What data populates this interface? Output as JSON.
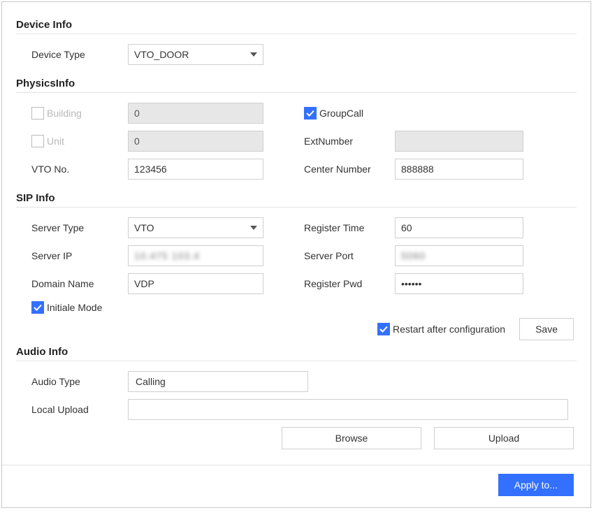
{
  "deviceInfo": {
    "title": "Device Info",
    "deviceTypeLabel": "Device Type",
    "deviceTypeValue": "VTO_DOOR"
  },
  "physicsInfo": {
    "title": "PhysicsInfo",
    "buildingLabel": "Building",
    "buildingChecked": false,
    "buildingValue": "0",
    "unitLabel": "Unit",
    "unitChecked": false,
    "unitValue": "0",
    "vtoNoLabel": "VTO No.",
    "vtoNoValue": "123456",
    "groupCallLabel": "GroupCall",
    "groupCallChecked": true,
    "extNumberLabel": "ExtNumber",
    "extNumberValue": "",
    "centerNumberLabel": "Center Number",
    "centerNumberValue": "888888"
  },
  "sipInfo": {
    "title": "SIP Info",
    "serverTypeLabel": "Server Type",
    "serverTypeValue": "VTO",
    "serverIpLabel": "Server IP",
    "serverIpValue": "10.475 103.4",
    "domainNameLabel": "Domain Name",
    "domainNameValue": "VDP",
    "initModeLabel": "Initiale Mode",
    "initModeChecked": true,
    "registerTimeLabel": "Register Time",
    "registerTimeValue": "60",
    "serverPortLabel": "Server Port",
    "serverPortValue": "5060",
    "registerPwdLabel": "Register Pwd",
    "registerPwdValue": "••••••",
    "restartLabel": "Restart after configuration",
    "restartChecked": true,
    "saveLabel": "Save"
  },
  "audioInfo": {
    "title": "Audio Info",
    "audioTypeLabel": "Audio Type",
    "audioTypeValue": "Calling",
    "localUploadLabel": "Local Upload",
    "browseLabel": "Browse",
    "uploadLabel": "Upload"
  },
  "footer": {
    "applyLabel": "Apply to..."
  }
}
